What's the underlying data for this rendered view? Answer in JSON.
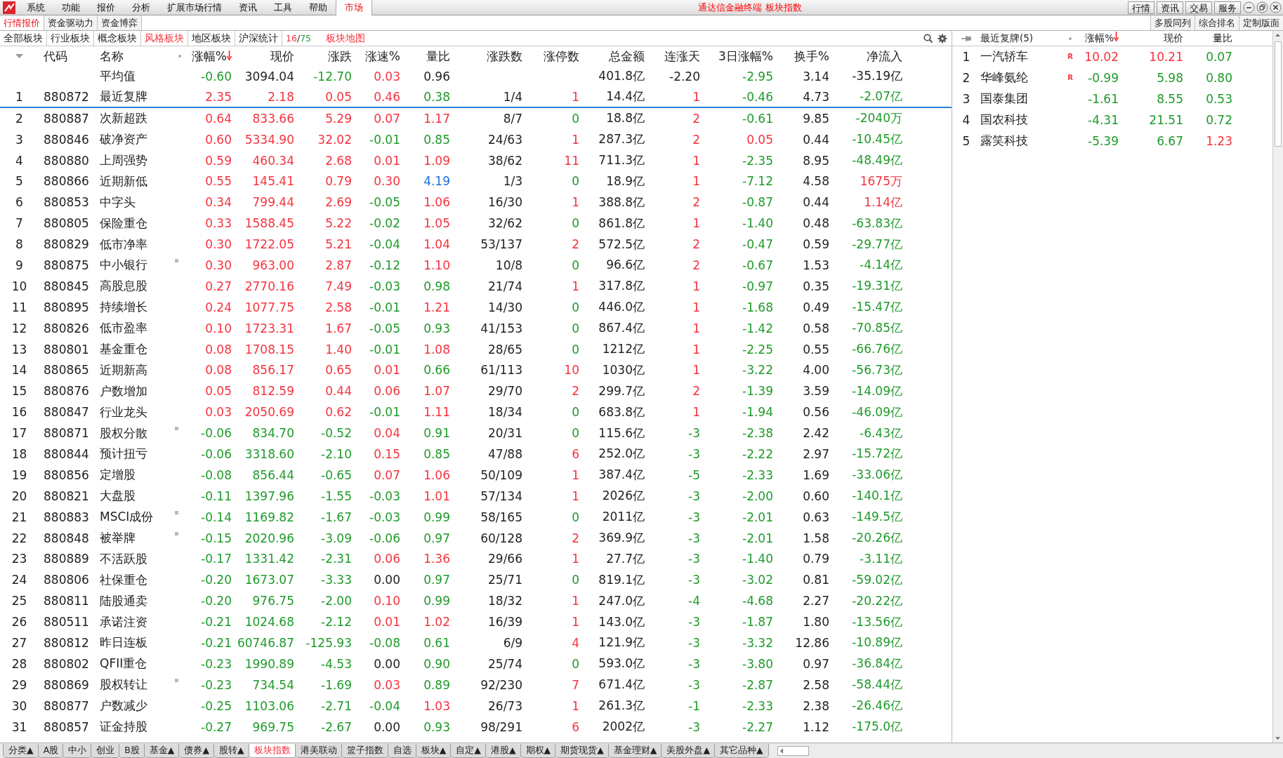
{
  "menu": {
    "items": [
      "系统",
      "功能",
      "报价",
      "分析",
      "扩展市场行情",
      "资讯",
      "工具",
      "帮助"
    ],
    "market_tab": "市场",
    "title": "通达信金融终端 板块指数",
    "buttons": [
      "行情",
      "资讯",
      "交易",
      "服务"
    ]
  },
  "subtabs": [
    {
      "label": "行情报价",
      "selected": true
    },
    {
      "label": "资金驱动力",
      "selected": false
    },
    {
      "label": "资金博弈",
      "selected": false
    }
  ],
  "layout_buttons": [
    "多股同列",
    "综合排名",
    "定制版面"
  ],
  "categories": [
    {
      "label": "全部板块",
      "selected": false
    },
    {
      "label": "行业板块",
      "selected": false
    },
    {
      "label": "概念板块",
      "selected": false
    },
    {
      "label": "风格板块",
      "selected": true
    },
    {
      "label": "地区板块",
      "selected": false
    },
    {
      "label": "沪深统计",
      "selected": false
    }
  ],
  "pager": {
    "page": "16",
    "sep": "/",
    "total": "75"
  },
  "map_link": "板块地图",
  "columns": [
    {
      "label": "代码",
      "sorted": false
    },
    {
      "label": "名称",
      "sorted": false
    },
    {
      "label": "涨幅%",
      "sorted": true,
      "kind": "sign"
    },
    {
      "label": "现价",
      "sorted": false,
      "kind": "lead"
    },
    {
      "label": "涨跌",
      "sorted": false,
      "kind": "sign"
    },
    {
      "label": "涨速%",
      "sorted": false,
      "kind": "sign"
    },
    {
      "label": "量比",
      "sorted": false,
      "kind": "ratio"
    },
    {
      "label": "涨跌数",
      "sorted": false,
      "kind": "plain"
    },
    {
      "label": "涨停数",
      "sorted": false,
      "kind": "count"
    },
    {
      "label": "总金额",
      "sorted": false,
      "kind": "plain"
    },
    {
      "label": "连涨天",
      "sorted": false,
      "kind": "sign"
    },
    {
      "label": "3日涨幅%",
      "sorted": false,
      "kind": "sign"
    },
    {
      "label": "换手%",
      "sorted": false,
      "kind": "plain"
    },
    {
      "label": "净流入",
      "sorted": false,
      "kind": "sign"
    }
  ],
  "average": {
    "label": "平均值",
    "cells": [
      {
        "text": "-0.60",
        "kind": "down"
      },
      {
        "text": "3094.04",
        "kind": "flat"
      },
      {
        "text": "-12.70",
        "kind": "down"
      },
      {
        "text": "0.03",
        "kind": "up"
      },
      {
        "text": "0.96",
        "kind": "flat"
      },
      null,
      null,
      {
        "text": "401.8亿",
        "kind": "flat"
      },
      {
        "text": "-2.20",
        "kind": "flat"
      },
      {
        "text": "-2.95",
        "kind": "down"
      },
      {
        "text": "3.14",
        "kind": "flat"
      },
      {
        "text": "-35.19亿",
        "kind": "flat"
      }
    ]
  },
  "rows": [
    {
      "no": "1",
      "code": "880872",
      "name": "最近复牌",
      "selected": true,
      "marked": false,
      "cells": [
        "2.35",
        "2.18",
        "0.05",
        "0.46",
        "0.38",
        "1/4",
        "1",
        "14.4亿",
        "1",
        "-0.46",
        "4.73",
        "-2.07亿"
      ]
    },
    {
      "no": "2",
      "code": "880887",
      "name": "次新超跌",
      "selected": false,
      "marked": false,
      "cells": [
        "0.64",
        "833.66",
        "5.29",
        "0.07",
        "1.17",
        "8/7",
        "0",
        "18.8亿",
        "2",
        "-0.61",
        "9.85",
        "-2040万"
      ]
    },
    {
      "no": "3",
      "code": "880846",
      "name": "破净资产",
      "selected": false,
      "marked": false,
      "cells": [
        "0.60",
        "5334.90",
        "32.02",
        "-0.01",
        "0.85",
        "24/63",
        "1",
        "287.3亿",
        "2",
        "0.05",
        "0.44",
        "-10.45亿"
      ]
    },
    {
      "no": "4",
      "code": "880880",
      "name": "上周强势",
      "selected": false,
      "marked": false,
      "cells": [
        "0.59",
        "460.34",
        "2.68",
        "0.01",
        "1.09",
        "38/62",
        "11",
        "711.3亿",
        "1",
        "-2.35",
        "8.95",
        "-48.49亿"
      ]
    },
    {
      "no": "5",
      "code": "880866",
      "name": "近期新低",
      "selected": false,
      "marked": false,
      "cells": [
        "0.55",
        "145.41",
        "0.79",
        "0.30",
        "4.19",
        "1/3",
        "0",
        "18.9亿",
        "1",
        "-7.12",
        "4.58",
        "1675万"
      ]
    },
    {
      "no": "6",
      "code": "880853",
      "name": "中字头",
      "selected": false,
      "marked": false,
      "cells": [
        "0.34",
        "799.44",
        "2.69",
        "-0.05",
        "1.06",
        "16/30",
        "1",
        "388.8亿",
        "2",
        "-0.87",
        "0.44",
        "1.14亿"
      ]
    },
    {
      "no": "7",
      "code": "880805",
      "name": "保险重仓",
      "selected": false,
      "marked": false,
      "cells": [
        "0.33",
        "1588.45",
        "5.22",
        "-0.02",
        "1.05",
        "32/62",
        "0",
        "861.8亿",
        "1",
        "-1.40",
        "0.48",
        "-63.83亿"
      ]
    },
    {
      "no": "8",
      "code": "880829",
      "name": "低市净率",
      "selected": false,
      "marked": false,
      "cells": [
        "0.30",
        "1722.05",
        "5.21",
        "-0.04",
        "1.04",
        "53/137",
        "2",
        "572.5亿",
        "2",
        "-0.47",
        "0.59",
        "-29.77亿"
      ]
    },
    {
      "no": "9",
      "code": "880875",
      "name": "中小银行",
      "selected": false,
      "marked": true,
      "cells": [
        "0.30",
        "963.00",
        "2.87",
        "-0.12",
        "1.10",
        "10/8",
        "0",
        "96.6亿",
        "2",
        "-0.67",
        "1.53",
        "-4.14亿"
      ]
    },
    {
      "no": "10",
      "code": "880845",
      "name": "高股息股",
      "selected": false,
      "marked": false,
      "cells": [
        "0.27",
        "2770.16",
        "7.49",
        "-0.03",
        "0.98",
        "21/74",
        "1",
        "317.8亿",
        "1",
        "-0.97",
        "0.35",
        "-19.31亿"
      ]
    },
    {
      "no": "11",
      "code": "880895",
      "name": "持续增长",
      "selected": false,
      "marked": false,
      "cells": [
        "0.24",
        "1077.75",
        "2.58",
        "-0.01",
        "1.21",
        "14/30",
        "0",
        "446.0亿",
        "1",
        "-1.68",
        "0.49",
        "-15.47亿"
      ]
    },
    {
      "no": "12",
      "code": "880826",
      "name": "低市盈率",
      "selected": false,
      "marked": false,
      "cells": [
        "0.10",
        "1723.31",
        "1.67",
        "-0.05",
        "0.93",
        "41/153",
        "0",
        "867.4亿",
        "1",
        "-1.42",
        "0.58",
        "-70.85亿"
      ]
    },
    {
      "no": "13",
      "code": "880801",
      "name": "基金重仓",
      "selected": false,
      "marked": false,
      "cells": [
        "0.08",
        "1708.15",
        "1.40",
        "-0.01",
        "1.08",
        "28/65",
        "0",
        "1212亿",
        "1",
        "-2.25",
        "0.55",
        "-66.76亿"
      ]
    },
    {
      "no": "14",
      "code": "880865",
      "name": "近期新高",
      "selected": false,
      "marked": false,
      "cells": [
        "0.08",
        "856.17",
        "0.65",
        "0.01",
        "0.66",
        "61/113",
        "10",
        "1030亿",
        "1",
        "-3.22",
        "4.00",
        "-56.73亿"
      ]
    },
    {
      "no": "15",
      "code": "880876",
      "name": "户数增加",
      "selected": false,
      "marked": false,
      "cells": [
        "0.05",
        "812.59",
        "0.44",
        "0.06",
        "1.07",
        "29/70",
        "2",
        "299.7亿",
        "2",
        "-1.39",
        "3.59",
        "-14.09亿"
      ]
    },
    {
      "no": "16",
      "code": "880847",
      "name": "行业龙头",
      "selected": false,
      "marked": false,
      "cells": [
        "0.03",
        "2050.69",
        "0.62",
        "-0.01",
        "1.11",
        "18/34",
        "0",
        "683.8亿",
        "1",
        "-1.94",
        "0.56",
        "-46.09亿"
      ]
    },
    {
      "no": "17",
      "code": "880871",
      "name": "股权分散",
      "selected": false,
      "marked": true,
      "cells": [
        "-0.06",
        "834.70",
        "-0.52",
        "0.04",
        "0.91",
        "20/31",
        "0",
        "115.6亿",
        "-3",
        "-2.38",
        "2.42",
        "-6.43亿"
      ]
    },
    {
      "no": "18",
      "code": "880844",
      "name": "预计扭亏",
      "selected": false,
      "marked": false,
      "cells": [
        "-0.06",
        "3318.60",
        "-2.10",
        "0.15",
        "0.85",
        "47/88",
        "6",
        "252.0亿",
        "-3",
        "-2.22",
        "2.97",
        "-15.72亿"
      ]
    },
    {
      "no": "19",
      "code": "880856",
      "name": "定增股",
      "selected": false,
      "marked": false,
      "cells": [
        "-0.08",
        "856.44",
        "-0.65",
        "0.07",
        "1.06",
        "50/109",
        "1",
        "387.4亿",
        "-5",
        "-2.33",
        "1.69",
        "-33.06亿"
      ]
    },
    {
      "no": "20",
      "code": "880821",
      "name": "大盘股",
      "selected": false,
      "marked": false,
      "cells": [
        "-0.11",
        "1397.96",
        "-1.55",
        "-0.03",
        "1.01",
        "57/134",
        "1",
        "2026亿",
        "-3",
        "-2.00",
        "0.60",
        "-140.1亿"
      ]
    },
    {
      "no": "21",
      "code": "880883",
      "name": "MSCI成份",
      "selected": false,
      "marked": true,
      "cells": [
        "-0.14",
        "1169.82",
        "-1.67",
        "-0.03",
        "0.99",
        "58/165",
        "0",
        "2011亿",
        "-3",
        "-2.01",
        "0.63",
        "-149.5亿"
      ]
    },
    {
      "no": "22",
      "code": "880848",
      "name": "被举牌",
      "selected": false,
      "marked": true,
      "cells": [
        "-0.15",
        "2020.96",
        "-3.09",
        "-0.06",
        "0.97",
        "60/128",
        "2",
        "369.9亿",
        "-3",
        "-2.01",
        "1.58",
        "-20.26亿"
      ]
    },
    {
      "no": "23",
      "code": "880889",
      "name": "不活跃股",
      "selected": false,
      "marked": false,
      "cells": [
        "-0.17",
        "1331.42",
        "-2.31",
        "0.06",
        "1.36",
        "29/66",
        "1",
        "27.7亿",
        "-3",
        "-1.40",
        "0.79",
        "-3.11亿"
      ]
    },
    {
      "no": "24",
      "code": "880806",
      "name": "社保重仓",
      "selected": false,
      "marked": false,
      "cells": [
        "-0.20",
        "1673.07",
        "-3.33",
        "0.00",
        "0.97",
        "25/71",
        "0",
        "819.1亿",
        "-3",
        "-3.02",
        "0.81",
        "-59.02亿"
      ]
    },
    {
      "no": "25",
      "code": "880811",
      "name": "陆股通卖",
      "selected": false,
      "marked": false,
      "cells": [
        "-0.20",
        "976.75",
        "-2.00",
        "0.10",
        "0.99",
        "18/32",
        "1",
        "247.0亿",
        "-4",
        "-4.68",
        "2.27",
        "-20.22亿"
      ]
    },
    {
      "no": "26",
      "code": "880511",
      "name": "承诺注资",
      "selected": false,
      "marked": false,
      "cells": [
        "-0.21",
        "1024.68",
        "-2.12",
        "0.01",
        "1.02",
        "16/39",
        "1",
        "143.0亿",
        "-3",
        "-1.87",
        "1.80",
        "-13.56亿"
      ]
    },
    {
      "no": "27",
      "code": "880812",
      "name": "昨日连板",
      "selected": false,
      "marked": false,
      "cells": [
        "-0.21",
        "60746.87",
        "-125.93",
        "-0.08",
        "0.61",
        "6/9",
        "4",
        "121.9亿",
        "-3",
        "-3.32",
        "12.86",
        "-10.89亿"
      ]
    },
    {
      "no": "28",
      "code": "880802",
      "name": "QFII重仓",
      "selected": false,
      "marked": false,
      "cells": [
        "-0.23",
        "1990.89",
        "-4.53",
        "0.00",
        "0.90",
        "25/74",
        "0",
        "593.0亿",
        "-3",
        "-3.80",
        "0.97",
        "-36.84亿"
      ]
    },
    {
      "no": "29",
      "code": "880869",
      "name": "股权转让",
      "selected": false,
      "marked": true,
      "cells": [
        "-0.23",
        "734.54",
        "-1.69",
        "0.03",
        "0.89",
        "92/230",
        "7",
        "671.4亿",
        "-3",
        "-2.87",
        "2.58",
        "-58.44亿"
      ]
    },
    {
      "no": "30",
      "code": "880877",
      "name": "户数减少",
      "selected": false,
      "marked": false,
      "cells": [
        "-0.25",
        "1103.06",
        "-2.71",
        "-0.04",
        "1.03",
        "26/73",
        "1",
        "261.3亿",
        "-1",
        "-2.33",
        "2.38",
        "-26.46亿"
      ]
    },
    {
      "no": "31",
      "code": "880857",
      "name": "证金持股",
      "selected": false,
      "marked": false,
      "cells": [
        "-0.27",
        "969.75",
        "-2.67",
        "0.00",
        "0.93",
        "98/291",
        "6",
        "2002亿",
        "-3",
        "-2.27",
        "1.12",
        "-175.0亿"
      ]
    }
  ],
  "side": {
    "title": "最近复牌(5)",
    "columns": [
      {
        "label": "涨幅%",
        "sorted": true,
        "kind": "sign"
      },
      {
        "label": "现价",
        "sorted": false,
        "kind": "lead"
      },
      {
        "label": "量比",
        "sorted": false,
        "kind": "ratio"
      }
    ],
    "rows": [
      {
        "no": "1",
        "name": "一汽轿车",
        "flag": "R",
        "cells": [
          "10.02",
          "10.21",
          "0.07"
        ]
      },
      {
        "no": "2",
        "name": "华峰氨纶",
        "flag": "R",
        "cells": [
          "-0.99",
          "5.98",
          "0.80"
        ]
      },
      {
        "no": "3",
        "name": "国泰集团",
        "cells": [
          "-1.61",
          "8.55",
          "0.53"
        ]
      },
      {
        "no": "4",
        "name": "国农科技",
        "cells": [
          "-4.31",
          "21.51",
          "0.72"
        ]
      },
      {
        "no": "5",
        "name": "露笑科技",
        "cells": [
          "-5.39",
          "6.67",
          "1.23"
        ]
      }
    ]
  },
  "bottom_tabs": [
    {
      "label": "分类▲",
      "selected": false
    },
    {
      "label": "A股",
      "selected": false
    },
    {
      "label": "中小",
      "selected": false
    },
    {
      "label": "创业",
      "selected": false
    },
    {
      "label": "B股",
      "selected": false
    },
    {
      "label": "基金▲",
      "selected": false
    },
    {
      "label": "债券▲",
      "selected": false
    },
    {
      "label": "股转▲",
      "selected": false
    },
    {
      "label": "板块指数",
      "selected": true
    },
    {
      "label": "港美联动",
      "selected": false
    },
    {
      "label": "篮子指数",
      "selected": false
    },
    {
      "label": "自选",
      "selected": false
    },
    {
      "label": "板块▲",
      "selected": false
    },
    {
      "label": "自定▲",
      "selected": false
    },
    {
      "label": "港股▲",
      "selected": false
    },
    {
      "label": "期权▲",
      "selected": false
    },
    {
      "label": "期货现货▲",
      "selected": false
    },
    {
      "label": "基金理财▲",
      "selected": false
    },
    {
      "label": "美股外盘▲",
      "selected": false
    },
    {
      "label": "其它品种▲",
      "selected": false
    }
  ]
}
